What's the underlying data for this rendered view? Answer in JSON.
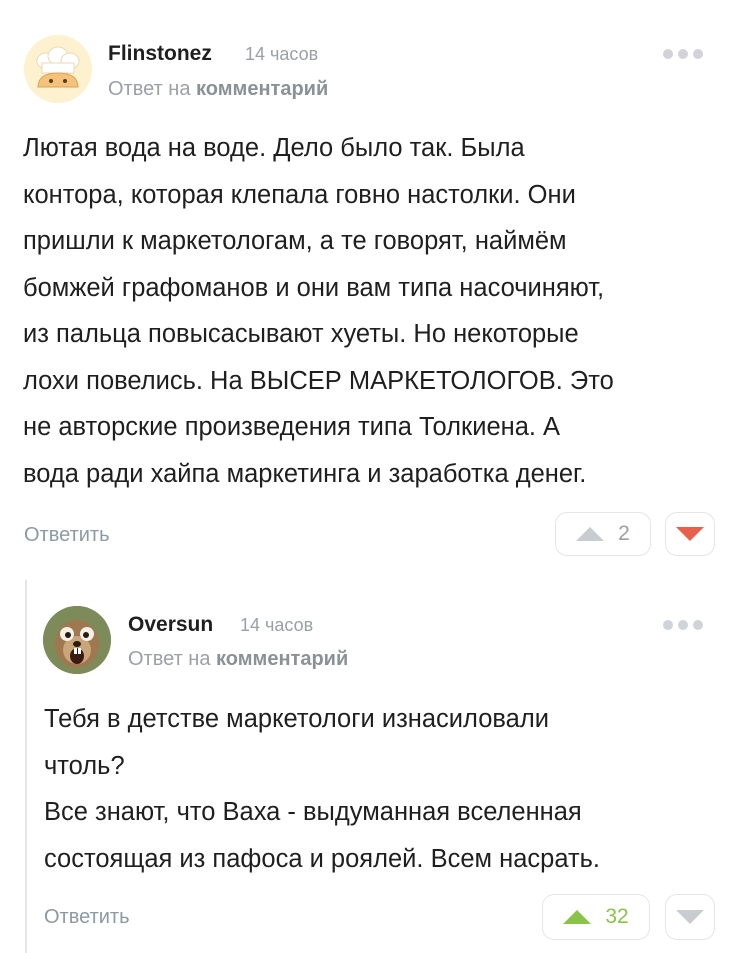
{
  "comments": [
    {
      "author": "Flinstonez",
      "time": "14 часов",
      "reply_prefix": "Ответ на",
      "reply_link": "комментарий",
      "text_lines": [
        "Лютая вода на воде. Дело было так. Была",
        "контора, которая клепала говно настолки. Они",
        "пришли к маркетологам, а те говорят, наймём",
        "бомжей графоманов и они вам типа насочиняют,",
        "из пальца повысасывают хуеты. Но некоторые",
        "лохи повелись. На ВЫСЕР МАРКЕТОЛОГОВ. Это",
        "не авторские произведения типа Толкиена. А",
        "вода ради хайпа маркетинга и заработка денег."
      ],
      "reply_label": "Ответить",
      "votes": "2",
      "upvote_color": "#c7ccd1",
      "downvote_color": "#e8604c",
      "avatar_icon": "chef-hat-bread-icon"
    },
    {
      "author": "Oversun",
      "time": "14 часов",
      "reply_prefix": "Ответ на",
      "reply_link": "комментарий",
      "text_lines": [
        "Тебя в детстве маркетологи изнасиловали",
        "чтоль?",
        "Все знают, что Ваха - выдуманная вселенная",
        "состоящая из пафоса и роялей. Всем насрать."
      ],
      "reply_label": "Ответить",
      "votes": "32",
      "upvote_color": "#8bc34a",
      "downvote_color": "#c7ccd1",
      "avatar_icon": "scrat-squirrel-icon"
    }
  ]
}
